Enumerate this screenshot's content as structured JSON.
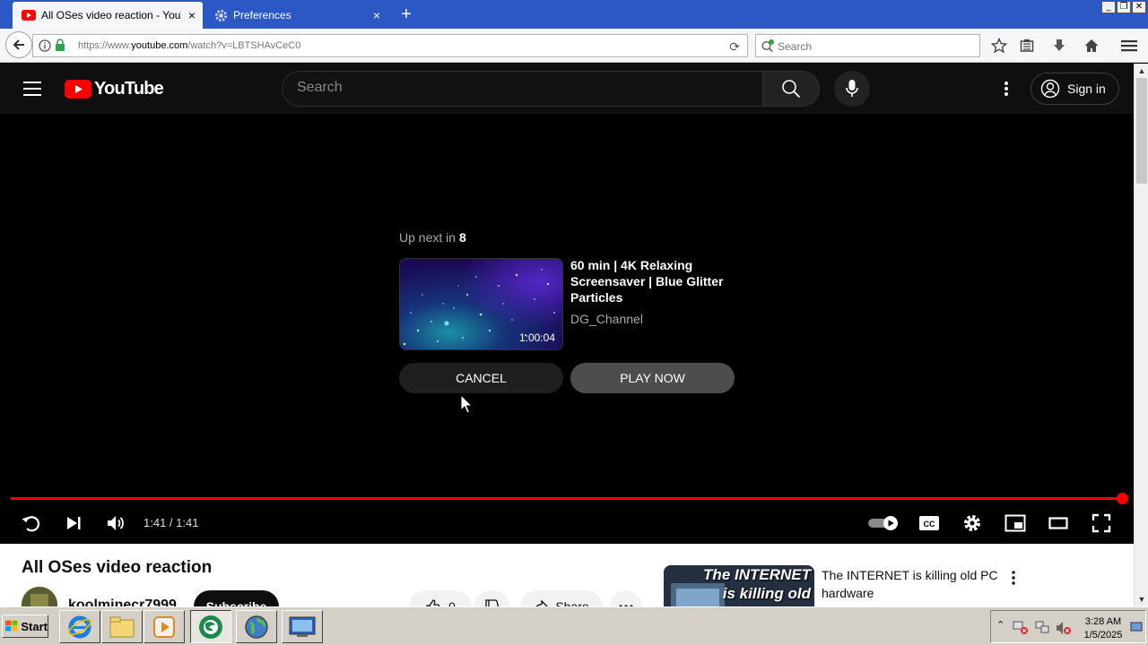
{
  "browser": {
    "tabs": [
      {
        "title": "All OSes video reaction - YouTube",
        "close": "×"
      },
      {
        "title": "Preferences",
        "close": "×"
      }
    ],
    "new_tab": "+",
    "url_prefix": "https://www.",
    "url_domain": "youtube.com",
    "url_path": "/watch?v=LBTSHAvCeC0",
    "search_placeholder": "Search"
  },
  "youtube": {
    "logo_text": "YouTube",
    "search_placeholder": "Search",
    "sign_in": "Sign in"
  },
  "player": {
    "upnext_prefix": "Up next in",
    "upnext_seconds": "8",
    "next_title": "60 min | 4K Relaxing Screensaver | Blue Glitter Particles",
    "next_channel": "DG_Channel",
    "next_duration": "1:00:04",
    "cancel_label": "CANCEL",
    "playnow_label": "PLAY NOW",
    "time": "1:41 / 1:41",
    "progress_fraction": 1.0
  },
  "video": {
    "title": "All OSes video reaction",
    "channel": "koolminecr7999",
    "subscribe": "Subscribe",
    "likes": "0",
    "share": "Share"
  },
  "recommendation": {
    "thumb_line1": "The INTERNET",
    "thumb_line2": "is killing old",
    "title": "The INTERNET is killing old PC hardware"
  },
  "taskbar": {
    "start": "Start",
    "clock_time": "3:28 AM",
    "clock_date": "1/5/2025"
  },
  "colors": {
    "youtube_red": "#ff0000",
    "firefox_tab_bar": "#2b58c4"
  }
}
